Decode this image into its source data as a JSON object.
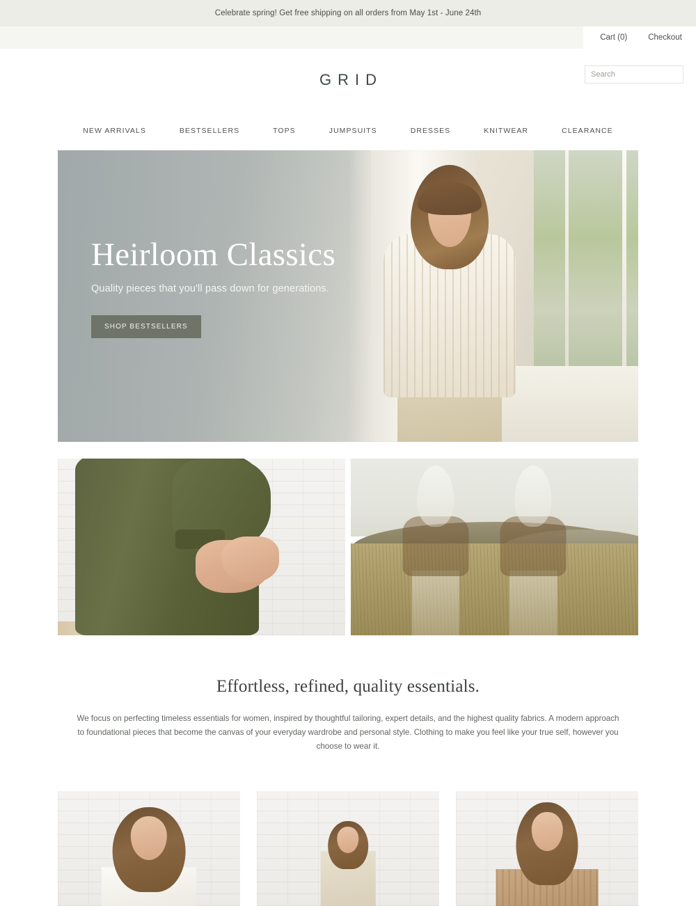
{
  "announcement": {
    "text": "Celebrate spring! Get free shipping on all orders from May 1st - June 24th"
  },
  "utility": {
    "cart_label": "Cart (0)",
    "checkout_label": "Checkout"
  },
  "header": {
    "logo": "GRID",
    "search": {
      "placeholder": "Search",
      "value": "",
      "icon": "search-icon"
    }
  },
  "nav": {
    "items": [
      {
        "label": "NEW ARRIVALS"
      },
      {
        "label": "BESTSELLERS"
      },
      {
        "label": "TOPS"
      },
      {
        "label": "JUMPSUITS"
      },
      {
        "label": "DRESSES"
      },
      {
        "label": "KNITWEAR"
      },
      {
        "label": "CLEARANCE"
      }
    ]
  },
  "hero": {
    "title": "Heirloom Classics",
    "subtitle": "Quality pieces that you'll pass down for generations.",
    "button_label": "SHOP BESTSELLERS",
    "image_alt": "Woman in cream cable-knit sweater leaning by a sunlit window"
  },
  "duo": {
    "left_alt": "Close-up of hands and olive green linen dress against white brick wall",
    "right_alt": "Double exposure of two women in a golden grass field with hills"
  },
  "intro": {
    "title": "Effortless, refined, quality essentials.",
    "body": "We focus on perfecting timeless essentials for women, inspired by thoughtful tailoring, expert details, and the highest quality fabrics. A modern approach to foundational pieces that become the canvas of your everyday wardrobe and personal style. Clothing to make you feel like your true self, however you choose to wear it."
  },
  "products": [
    {
      "alt": "Model in white button-down shirt against white brick wall"
    },
    {
      "alt": "Model in beige jumpsuit over striped long-sleeve top"
    },
    {
      "alt": "Model in tan cable-knit sweater against white brick wall"
    }
  ],
  "colors": {
    "announcement_bg": "#ecede6",
    "utility_bg": "#f5f6f1",
    "page_bg": "#ffffff",
    "logo": "#3f4a40",
    "hero_button": "#6e7468",
    "text": "#4a4f49"
  }
}
